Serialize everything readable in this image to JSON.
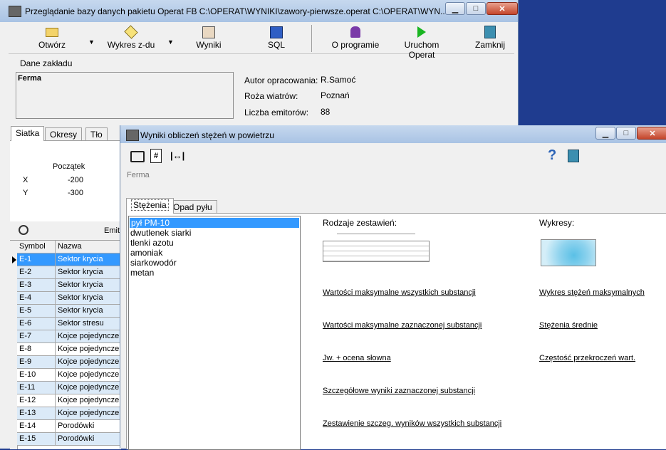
{
  "main_window": {
    "title": "Przeglądanie bazy danych pakietu Operat FB   C:\\OPERAT\\WYNIKI\\zawory-pierwsze.operat   C:\\OPERAT\\WYN...",
    "toolbar": {
      "open": "Otwórz",
      "chart": "Wykres z-du",
      "results": "Wyniki",
      "sql": "SQL",
      "about": "O programie",
      "run": "Uruchom Operat",
      "close": "Zamknij"
    },
    "company_label": "Dane zakładu",
    "company_name": "Ferma",
    "info": {
      "author_label": "Autor opracowania:",
      "author_value": "R.Samoć",
      "wind_label": "Roża wiatrów:",
      "wind_value": "Poznań",
      "emit_label": "Liczba emitorów:",
      "emit_value": "88"
    },
    "tabs": [
      "Siatka",
      "Okresy",
      "Tło"
    ],
    "grid_origin": {
      "header": "Początek",
      "x_label": "X",
      "x_value": "-200",
      "y_label": "Y",
      "y_value": "-300"
    },
    "emitters_label": "Emit",
    "table": {
      "col_symbol": "Symbol",
      "col_name": "Nazwa",
      "rows": [
        {
          "symbol": "E-1",
          "name": "Sektor krycia"
        },
        {
          "symbol": "E-2",
          "name": "Sektor krycia"
        },
        {
          "symbol": "E-3",
          "name": "Sektor krycia"
        },
        {
          "symbol": "E-4",
          "name": "Sektor krycia"
        },
        {
          "symbol": "E-5",
          "name": "Sektor krycia"
        },
        {
          "symbol": "E-6",
          "name": "Sektor stresu"
        },
        {
          "symbol": "E-7",
          "name": "Kojce pojedyncze"
        },
        {
          "symbol": "E-8",
          "name": "Kojce pojedyncze"
        },
        {
          "symbol": "E-9",
          "name": "Kojce pojedyncze"
        },
        {
          "symbol": "E-10",
          "name": "Kojce pojedyncze"
        },
        {
          "symbol": "E-11",
          "name": "Kojce pojedyncze"
        },
        {
          "symbol": "E-12",
          "name": "Kojce pojedyncze"
        },
        {
          "symbol": "E-13",
          "name": "Kojce pojedyncze"
        },
        {
          "symbol": "E-14",
          "name": "Porodówki"
        },
        {
          "symbol": "E-15",
          "name": "Porodówki"
        }
      ]
    }
  },
  "results_window": {
    "title": "Wyniki obliczeń stężeń w powietrzu",
    "help": "?",
    "company": "Ferma",
    "tabs": [
      "Stężenia",
      "Opad pyłu"
    ],
    "substances": [
      "pył PM-10",
      "dwutlenek siarki",
      "tlenki azotu",
      "amoniak",
      "siarkowodór",
      "metan"
    ],
    "reports_header": "Rodzaje zestawień:",
    "charts_header": "Wykresy:",
    "report_links": [
      "Wartości maksymalne wszystkich substancji",
      "Wartości maksymalne zaznaczonej substancji",
      "Jw. + ocena słowna",
      "Szczegółowe wyniki zaznaczonej substancji",
      "Zestawienie szczeg. wyników wszystkich substancji"
    ],
    "chart_links": [
      "Wykres stężeń maksymalnych",
      "Stężenia średnie",
      "Częstość przekroczeń wart."
    ]
  }
}
